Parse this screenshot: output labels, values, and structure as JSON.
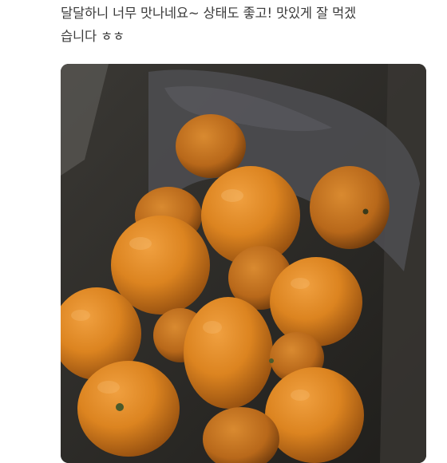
{
  "review": {
    "line1": "달달하니 너무 맛나네요~ 상태도 좋고! 맛있게 잘 먹겠",
    "line2": "습니다 ㅎㅎ"
  },
  "photo": {
    "subject": "tangerines-in-box",
    "colors": {
      "fruit": "#e0861f",
      "fruit_shadow": "#9a4f10",
      "box": "#2e2c28",
      "paper": "#4a4a4c",
      "background": "#ffffff"
    }
  }
}
